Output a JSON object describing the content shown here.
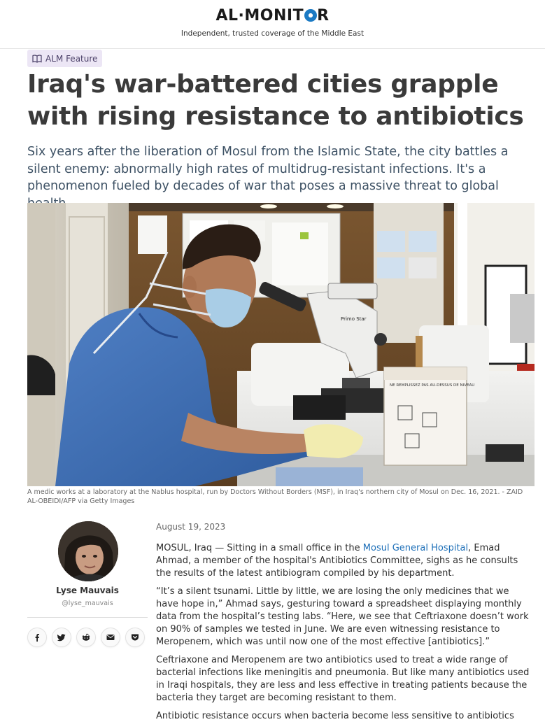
{
  "header": {
    "logo_left": "AL·MONIT",
    "logo_right": "R",
    "tagline": "Independent, trusted coverage of the Middle East"
  },
  "badge": {
    "label": "ALM Feature",
    "icon": "book-icon"
  },
  "headline": "Iraq's war-battered cities grapple with rising resistance to antibiotics",
  "dek": "Six years after the liberation of Mosul from the Islamic State, the city battles a silent enemy: abnormally high rates of multidrug-resistant infections. It's a phenomenon fueled by decades of war that poses a massive threat to global health.",
  "photo": {
    "box_label": "NE REMPLISSEZ PAS AU-DESSUS DE NIVEAU",
    "microscope_label": "Primo Star",
    "caption": "A medic works at a laboratory at the Nablus hospital, run by Doctors Without Borders (MSF), in Iraq's northern city of Mosul on Dec. 16, 2021. - ZAID AL-OBEIDI/AFP via Getty Images"
  },
  "author": {
    "name": "Lyse Mauvais",
    "handle": "@lyse_mauvais",
    "shares": [
      "facebook-icon",
      "twitter-icon",
      "reddit-icon",
      "email-icon",
      "pocket-icon"
    ]
  },
  "article": {
    "date": "August 19, 2023",
    "p1_before": "MOSUL, Iraq — Sitting in a small office in the ",
    "p1_link": "Mosul General Hospital",
    "p1_after": ", Emad Ahmad, a member of the hospital's Antibiotics Committee, sighs as he consults the results of the latest antibiogram compiled by his department.",
    "p2": "“It’s a silent tsunami. Little by little, we are losing the only medicines that we have hope in,” Ahmad says, gesturing toward a spreadsheet displaying monthly data from the hospital’s testing labs. “Here, we see that Ceftriaxone doesn’t work on 90% of samples we tested in June. We are even witnessing resistance to Meropenem, which was until now one of the most effective [antibiotics].”",
    "p3": "Ceftriaxone and Meropenem are two antibiotics used to treat a wide range of bacterial infections like meningitis and pneumonia. But like many antibiotics used in Iraqi hospitals, they are less and less effective in treating patients because the bacteria they target are becoming resistant to them.",
    "p4": "Antibiotic resistance occurs when bacteria become less sensitive to antibiotics"
  }
}
